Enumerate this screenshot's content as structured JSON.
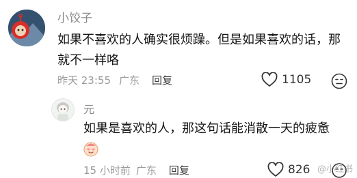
{
  "comments": [
    {
      "username": "小饺子",
      "text_line1": "如果不喜欢的人确实很烦躁。但是如果喜欢的话，那",
      "text_line2": "就不一样咯",
      "time": "昨天 23:55",
      "location": "广东",
      "reply_label": "回复",
      "likes": "1105"
    },
    {
      "username": "元",
      "text": "如果是喜欢的人，那这句话能消散一天的疲惫",
      "time": "15 小时前",
      "location": "广东",
      "reply_label": "回复",
      "likes": "826"
    }
  ],
  "watermark": "@小红书",
  "icons": [
    "heart-icon",
    "dislike-face-icon",
    "sticker-emoji"
  ]
}
